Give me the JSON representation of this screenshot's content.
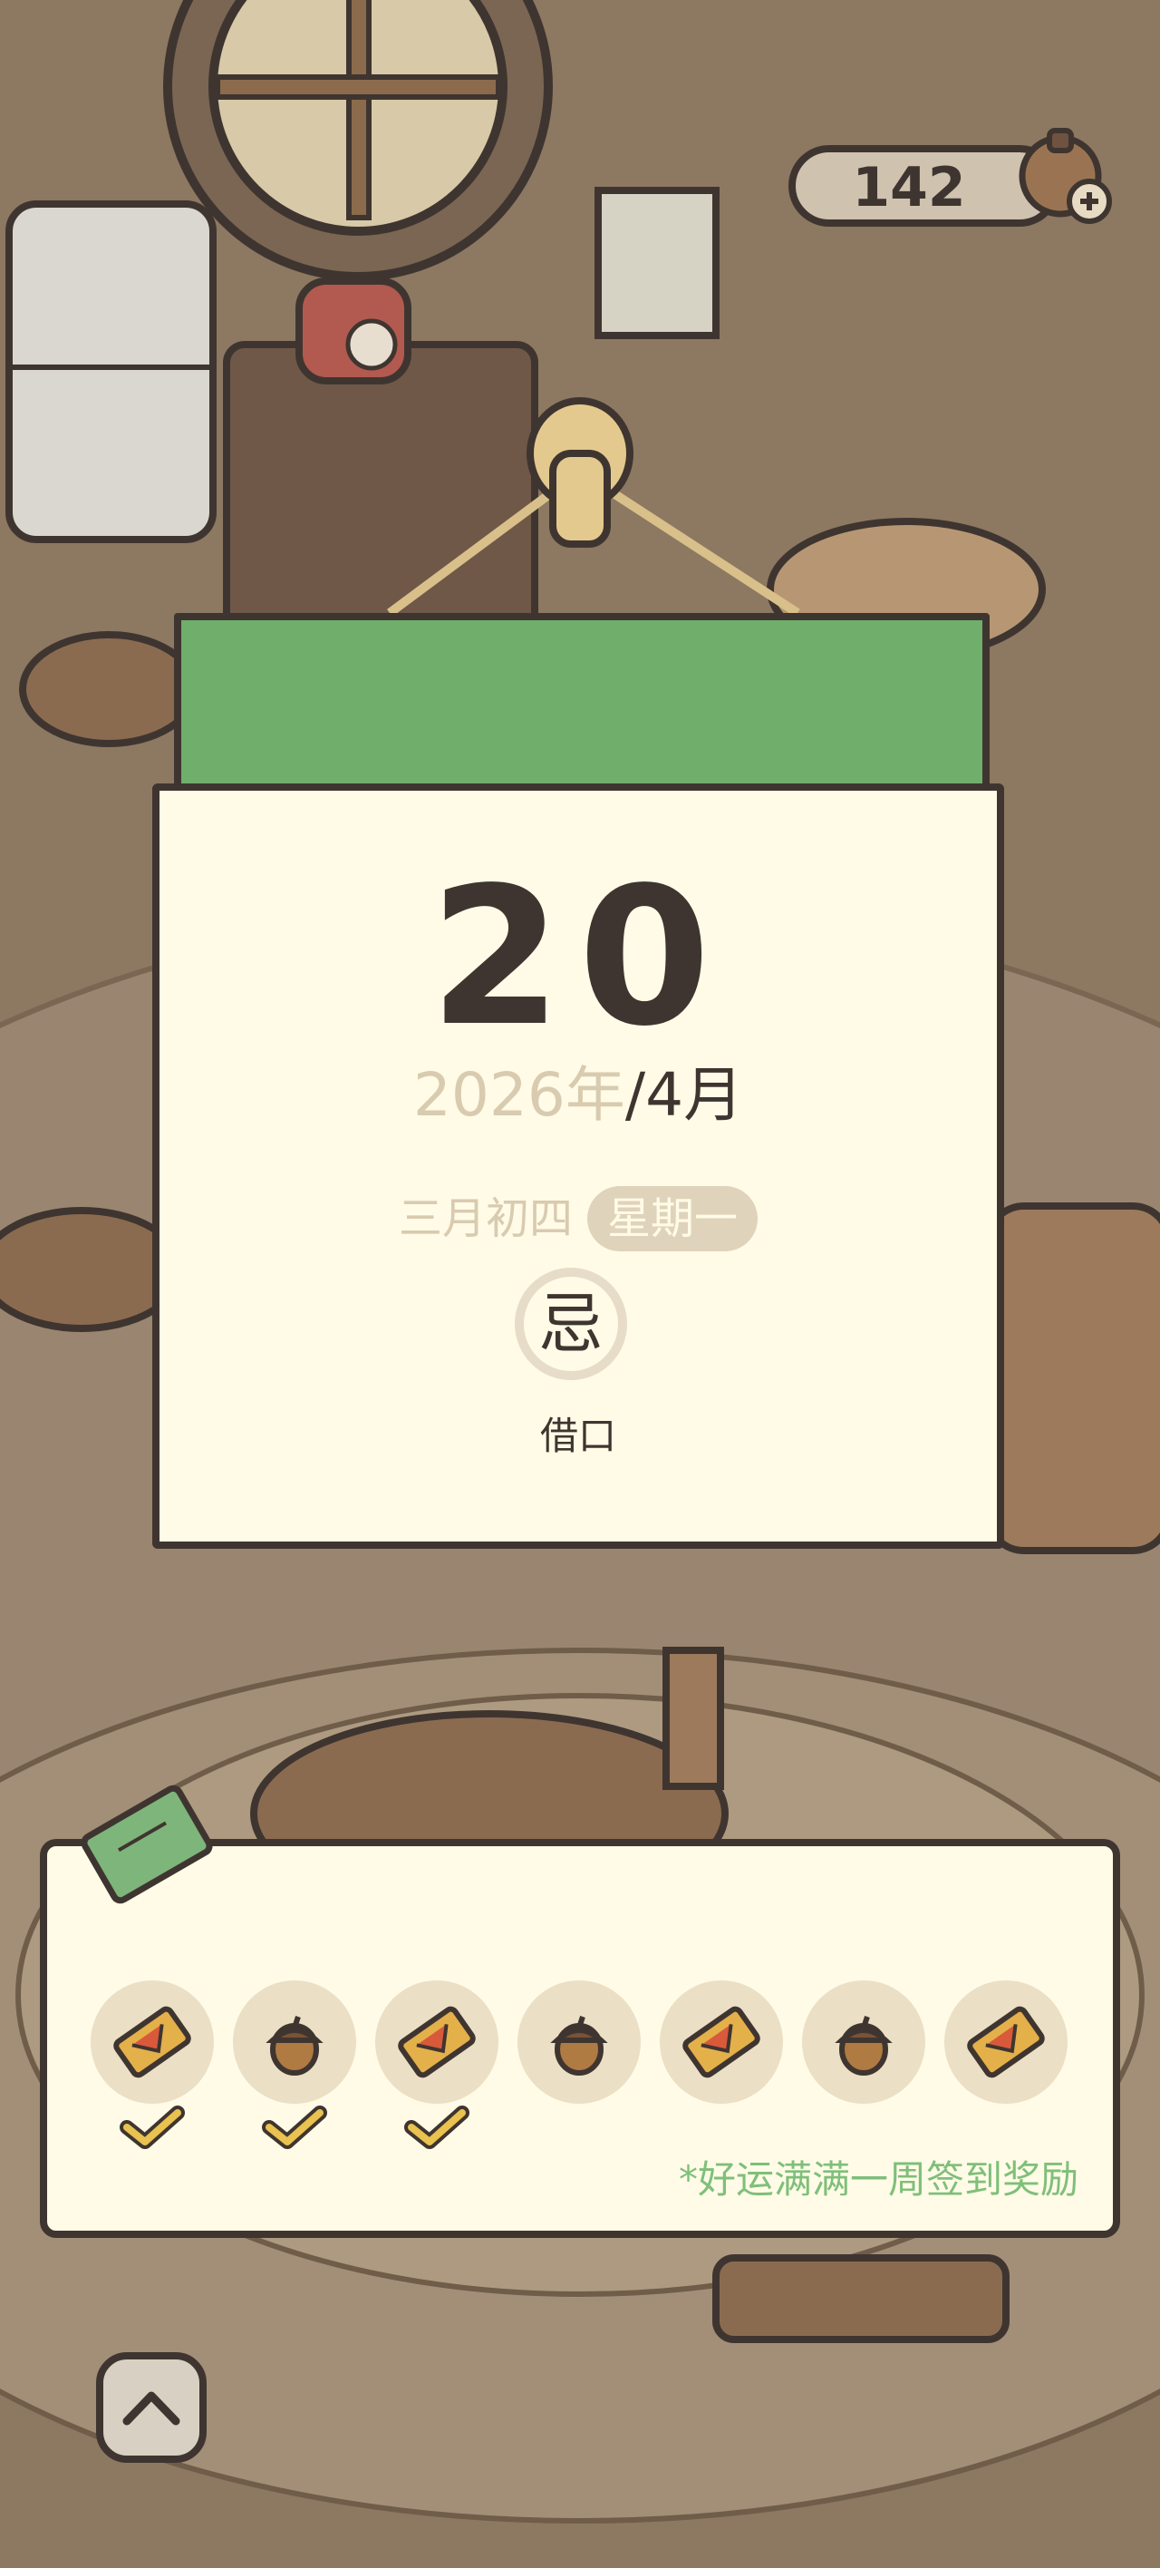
{
  "currency": {
    "value": "142",
    "add_icon": "plus-icon"
  },
  "calendar": {
    "day": "20",
    "year": "2026年",
    "month": "/4月",
    "lunar_date": "三月初四",
    "weekday": "星期一",
    "taboo_label": "忌",
    "taboo_text": "借口"
  },
  "rewards": {
    "note": "*好运满满一周签到奖励",
    "slots": [
      {
        "icon": "ticket-icon",
        "checked": true
      },
      {
        "icon": "acorn-icon",
        "checked": true
      },
      {
        "icon": "ticket-icon",
        "checked": true
      },
      {
        "icon": "acorn-icon",
        "checked": false
      },
      {
        "icon": "ticket-icon",
        "checked": false
      },
      {
        "icon": "acorn-icon",
        "checked": false
      },
      {
        "icon": "ticket-icon",
        "checked": false
      }
    ]
  },
  "colors": {
    "calendar_header": "#6fae6b",
    "paper": "#fffbe6",
    "ink": "#3f3530",
    "note_green": "#7fbf7a"
  }
}
